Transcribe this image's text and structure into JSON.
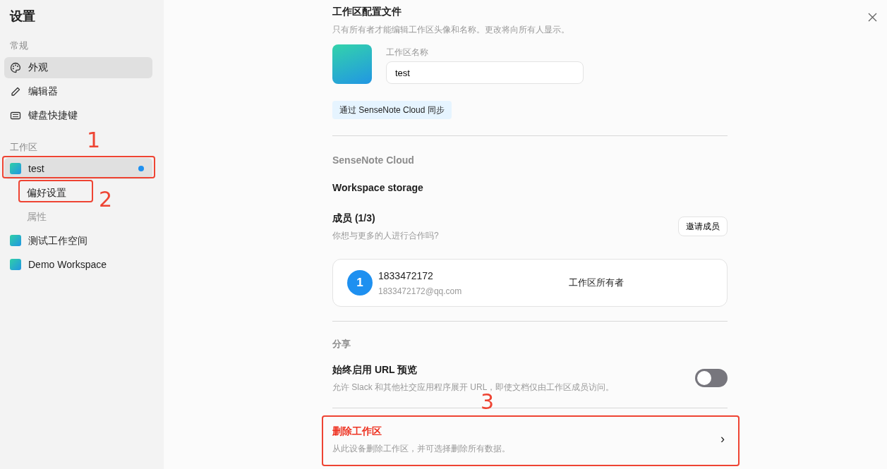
{
  "sidebar": {
    "title": "设置",
    "sections": [
      {
        "heading": "常规",
        "items": [
          {
            "kind": "palette",
            "label": "外观",
            "selected": true
          },
          {
            "kind": "pencil",
            "label": "编辑器",
            "selected": false
          },
          {
            "kind": "keyboard",
            "label": "键盘快捷键",
            "selected": false
          }
        ]
      },
      {
        "heading": "工作区",
        "items": [
          {
            "kind": "workspace",
            "label": "test",
            "selected": true,
            "indicator": true,
            "annotation": "1",
            "children": [
              {
                "label": "偏好设置",
                "selected": true,
                "annotation": "2"
              },
              {
                "label": "属性",
                "selected": false
              }
            ]
          },
          {
            "kind": "workspace",
            "label": "测试工作空间",
            "selected": false,
            "indicator": false
          },
          {
            "kind": "workspace",
            "label": "Demo Workspace",
            "selected": false,
            "indicator": false
          }
        ]
      }
    ]
  },
  "profile": {
    "title": "工作区配置文件",
    "description": "只有所有者才能编辑工作区头像和名称。更改将向所有人显示。",
    "name_label": "工作区名称",
    "name_value": "test",
    "sync_badge": "通过 SenseNote Cloud 同步"
  },
  "cloud": {
    "heading": "SenseNote Cloud",
    "storage_title": "Workspace storage"
  },
  "members": {
    "title": "成员 (1/3)",
    "description": "你想与更多的人进行合作吗?",
    "invite_button": "邀请成员",
    "list": [
      {
        "avatar": "1",
        "name": "1833472172",
        "email": "1833472172@qq.com",
        "role": "工作区所有者"
      }
    ]
  },
  "sharing": {
    "heading": "分享",
    "title": "始终启用 URL 预览",
    "description": "允许 Slack 和其他社交应用程序展开 URL，即使文档仅由工作区成员访问。",
    "on": false
  },
  "danger": {
    "title": "删除工作区",
    "description": "从此设备删除工作区，并可选择删除所有数据。",
    "chevron": "›",
    "annotation": "3"
  }
}
